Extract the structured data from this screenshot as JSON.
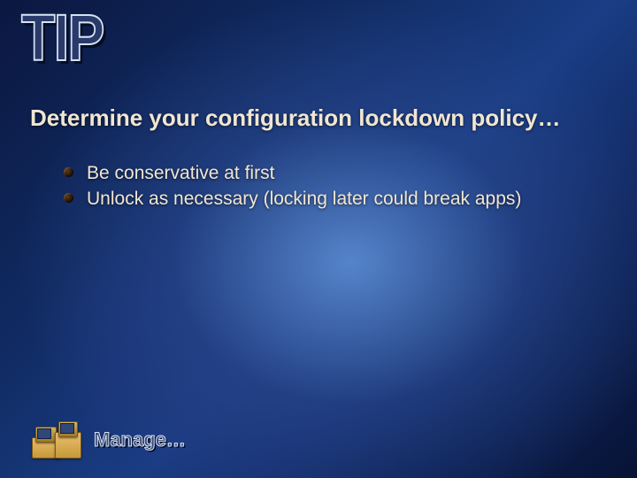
{
  "badge": "TIP",
  "heading": "Determine your configuration lockdown policy…",
  "bullets": [
    "Be conservative at first",
    "Unlock as necessary (locking later could break apps)"
  ],
  "footer_label": "Manage…"
}
